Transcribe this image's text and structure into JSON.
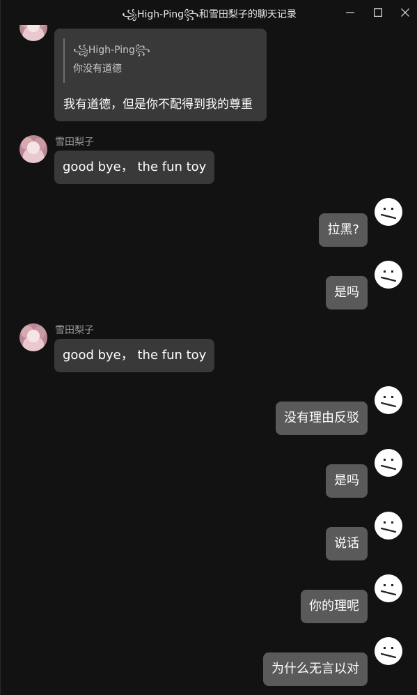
{
  "window": {
    "title": "꧁High-Ping꧂和雪田梨子的聊天记录"
  },
  "contacts": {
    "other_name": "雪田梨子",
    "quoted_name": "꧁High-Ping꧂"
  },
  "quoted": {
    "text": "你没有道德"
  },
  "messages": {
    "m0": "我有道德，但是你不配得到我的尊重",
    "m1": "good bye， the fun toy",
    "m2": "拉黑?",
    "m3": "是吗",
    "m4": "good bye， the fun toy",
    "m5": "没有理由反驳",
    "m6": "是吗",
    "m7": "说话",
    "m8": "你的理呢",
    "m9": "为什么无言以对"
  },
  "icons": {
    "minimize": "minimize-icon",
    "maximize": "maximize-icon",
    "close": "close-icon",
    "self_avatar": "confused-face-avatar",
    "other_avatar": "anime-girl-avatar"
  },
  "colors": {
    "background": "#121212",
    "incoming_bubble": "#393939",
    "outgoing_bubble": "#5a5a5a",
    "sender_text": "#9a9a9a"
  }
}
